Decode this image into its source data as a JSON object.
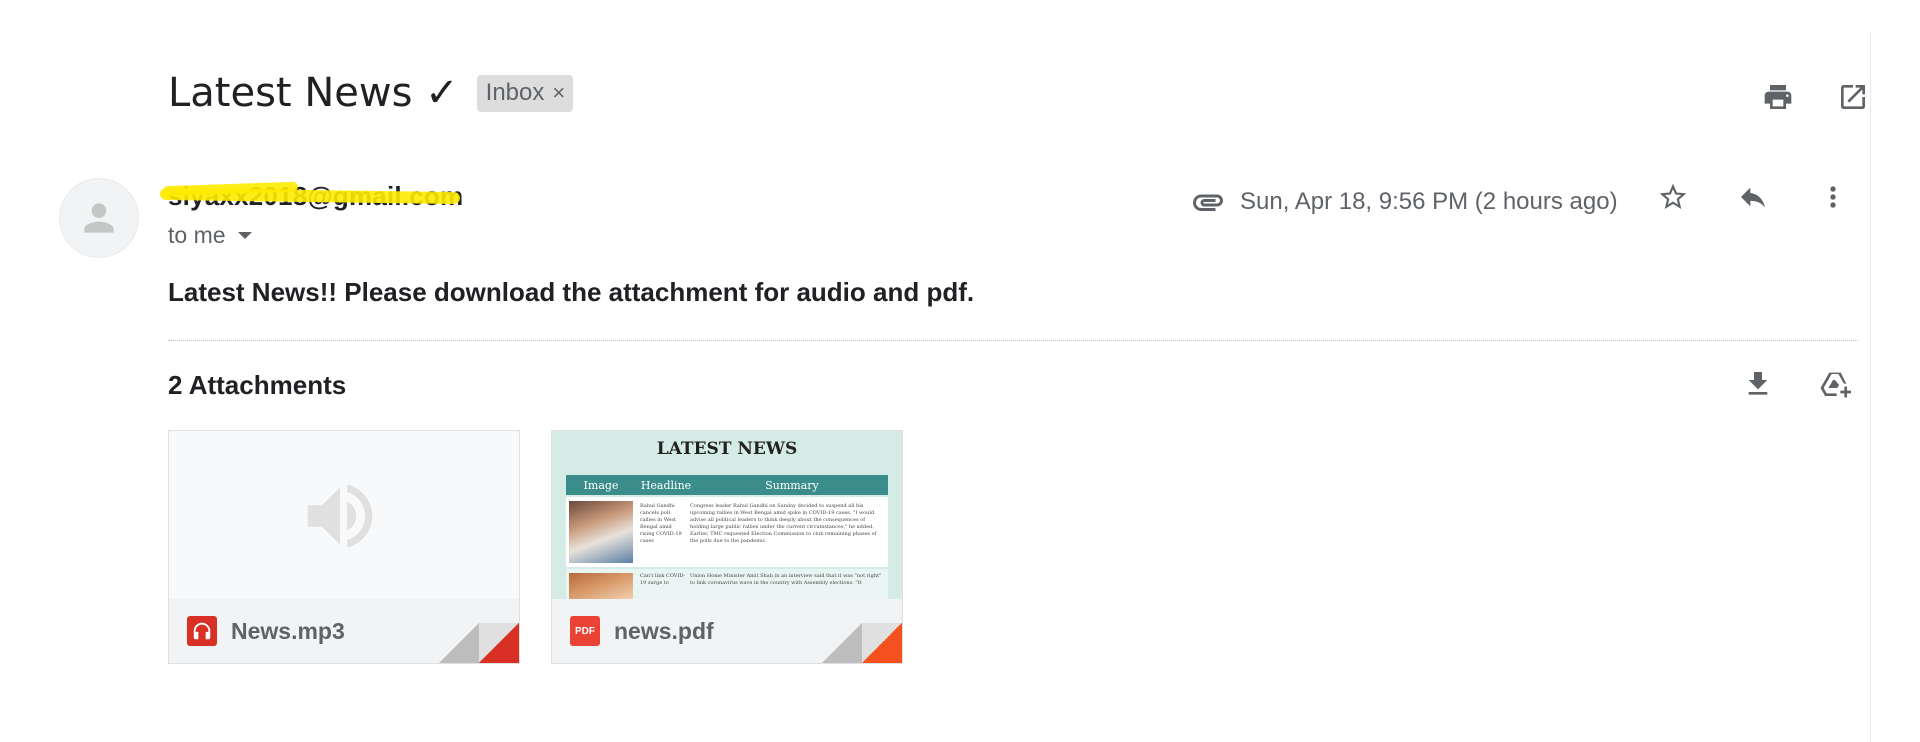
{
  "email": {
    "subject": "Latest News ✓",
    "label_chip": "Inbox",
    "label_chip_remove": "×",
    "sender": "siyaxx2018@gmail.com",
    "recipient_line": "to me",
    "date": "Sun, Apr 18, 9:56 PM (2 hours ago)",
    "body": "Latest News!! Please download the attachment for audio and pdf."
  },
  "attachments": {
    "title": "2 Attachments",
    "items": [
      {
        "filename": "News.mp3",
        "type_icon": "headphones-icon",
        "icon_color": "#d93025"
      },
      {
        "filename": "news.pdf",
        "type_icon": "pdf-icon",
        "icon_label": "PDF",
        "icon_color": "#ea4335"
      }
    ],
    "pdf_preview": {
      "title": "LATEST NEWS",
      "columns": [
        "Image",
        "Headline",
        "Summary"
      ],
      "rows": [
        {
          "headline": "Rahul Gandhi cancels poll rallies in West Bengal amid rising COVID-19 cases",
          "summary": "Congress leader Rahul Gandhi on Sunday decided to suspend all his upcoming rallies in West Bengal amid spike in COVID-19 cases. \"I would advise all political leaders to think deeply about the consequences of holding large public rallies under the current circumstances,\" he added. Earlier, TMC requested Election Commission to club remaining phases of the polls due to the pandemic."
        },
        {
          "headline": "Can't link COVID-19 surge to",
          "summary": "Union Home Minister Amit Shah in an interview said that it was \"not right\" to link coronavirus wave in the country with Assembly elections. \"It"
        }
      ]
    }
  },
  "icons": {
    "print": "print-icon",
    "open_new_window": "open-in-new-icon",
    "attachment": "paperclip-icon",
    "star": "star-icon",
    "reply": "reply-icon",
    "more": "more-vert-icon",
    "download_all": "download-icon",
    "save_to_drive": "add-to-drive-icon",
    "avatar": "avatar-icon",
    "audio_preview": "speaker-icon"
  },
  "colors": {
    "accent_red": "#d93025",
    "pdf_teal": "#3b8d8b",
    "redaction_yellow": "#ffeb00"
  }
}
